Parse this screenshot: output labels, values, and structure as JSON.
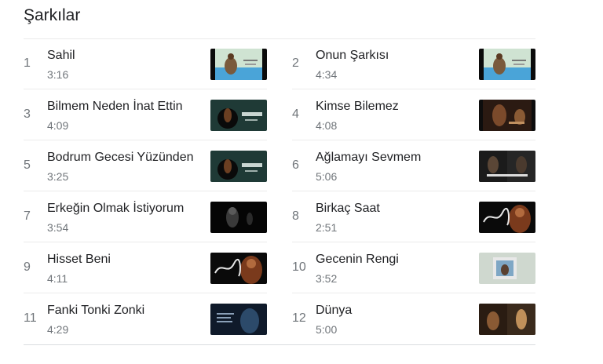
{
  "section": {
    "title": "Şarkılar"
  },
  "songs": [
    {
      "number": "1",
      "title": "Sahil",
      "duration": "3:16"
    },
    {
      "number": "2",
      "title": "Onun Şarkısı",
      "duration": "4:34"
    },
    {
      "number": "3",
      "title": "Bilmem Neden İnat Ettin",
      "duration": "4:09"
    },
    {
      "number": "4",
      "title": "Kimse Bilemez",
      "duration": "4:08"
    },
    {
      "number": "5",
      "title": "Bodrum Gecesi Yüzünden",
      "duration": "3:25"
    },
    {
      "number": "6",
      "title": "Ağlamayı Sevmem",
      "duration": "5:06"
    },
    {
      "number": "7",
      "title": "Erkeğin Olmak İstiyorum",
      "duration": "3:54"
    },
    {
      "number": "8",
      "title": "Birkaç Saat",
      "duration": "2:51"
    },
    {
      "number": "9",
      "title": "Hisset Beni",
      "duration": "4:11"
    },
    {
      "number": "10",
      "title": "Gecenin Rengi",
      "duration": "3:52"
    },
    {
      "number": "11",
      "title": "Fanki Tonki Zonki",
      "duration": "4:29"
    },
    {
      "number": "12",
      "title": "Dünya",
      "duration": "5:00"
    }
  ]
}
